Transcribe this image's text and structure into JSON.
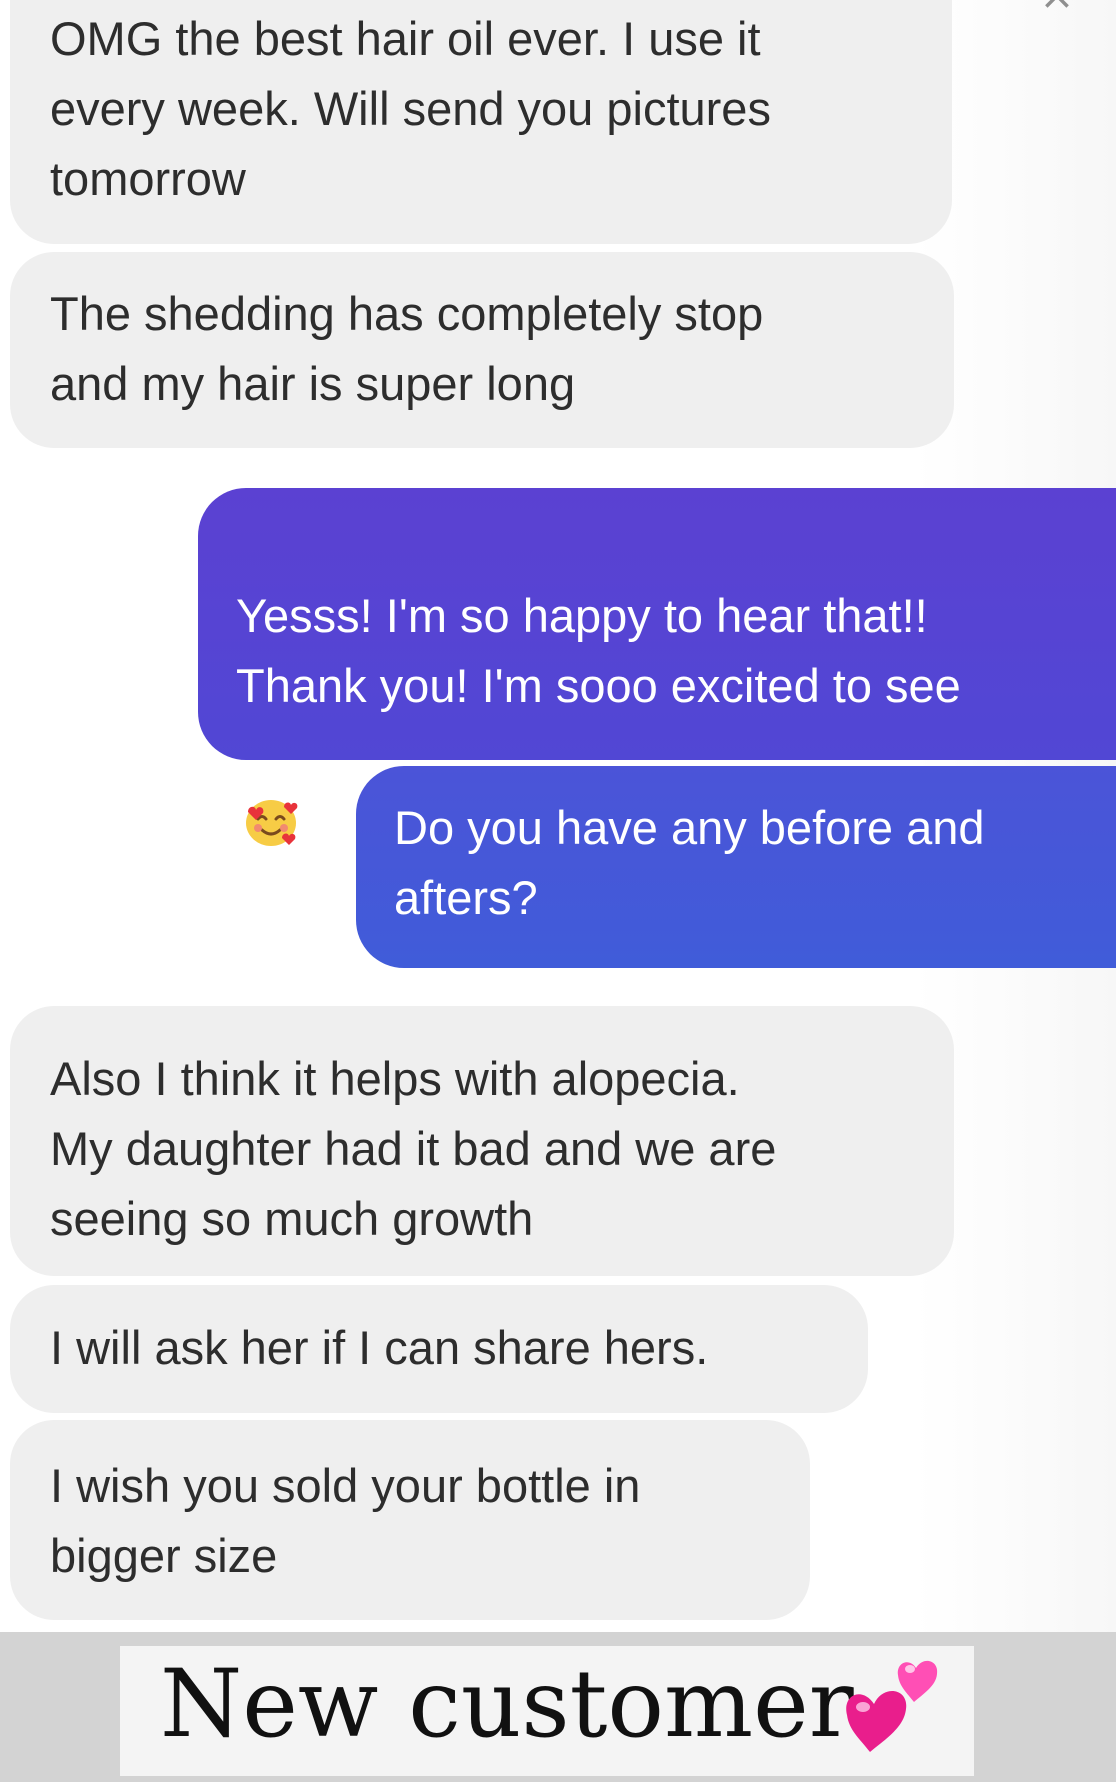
{
  "chat": {
    "close_symbol": "×",
    "messages": [
      {
        "direction": "received",
        "text": "OMG the best hair oil ever. I use it\nevery week. Will send you pictures\ntomorrow"
      },
      {
        "direction": "received",
        "text": "The shedding has completely stop\nand my hair is super long"
      },
      {
        "direction": "sent",
        "text": "Yesss! I'm so happy to hear that!!\nThank you! I'm sooo excited to see",
        "emoji": "smiling-face-with-hearts"
      },
      {
        "direction": "sent",
        "text": "Do you have any before and\nafters?"
      },
      {
        "direction": "received",
        "text": "Also I think it helps with alopecia.\nMy daughter had it bad and we are\nseeing so much growth"
      },
      {
        "direction": "received",
        "text": "I will ask her if I can share hers."
      },
      {
        "direction": "received",
        "text": "I wish you sold your bottle in\nbigger size"
      }
    ]
  },
  "caption": {
    "text": "New customer",
    "emoji": "two-hearts"
  },
  "colors": {
    "received_bubble": "#efefef",
    "sent_bubble_top": "#5b41d2",
    "sent_bubble_bottom": "#405cd9",
    "caption_band": "#d3d3d3",
    "hearts": "#e91e8c"
  }
}
